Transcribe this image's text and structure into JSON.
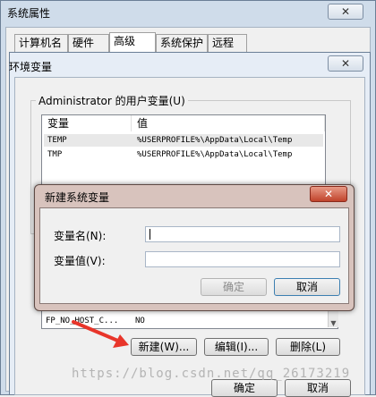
{
  "sysprops": {
    "title": "系统属性",
    "close": "✕",
    "tabs": [
      "计算机名",
      "硬件",
      "高级",
      "系统保护",
      "远程"
    ]
  },
  "envvars": {
    "title": "环境变量",
    "close": "✕",
    "user_group_label": "Administrator 的用户变量(U)",
    "columns": [
      "变量",
      "值"
    ],
    "rows": [
      {
        "name": "TEMP",
        "value": "%USERPROFILE%\\AppData\\Local\\Temp"
      },
      {
        "name": "TMP",
        "value": "%USERPROFILE%\\AppData\\Local\\Temp"
      }
    ],
    "system_rows": [
      {
        "name": "FP_NO_HOST_C...",
        "value": "NO"
      }
    ],
    "buttons": {
      "new": "新建(W)...",
      "edit": "编辑(I)...",
      "delete": "删除(L)"
    },
    "ok": "确定",
    "cancel": "取消"
  },
  "newvar": {
    "title": "新建系统变量",
    "close": "✕",
    "name_label": "变量名(N):",
    "value_label": "变量值(V):",
    "name_value": "",
    "value_value": "",
    "ok": "确定",
    "cancel": "取消"
  },
  "watermark": "https://blog.csdn.net/qq_26173219",
  "colors": {
    "arrow": "#e8352a",
    "dialog_frame": "#d8c3bd",
    "window_frame": "#cfdcea"
  }
}
